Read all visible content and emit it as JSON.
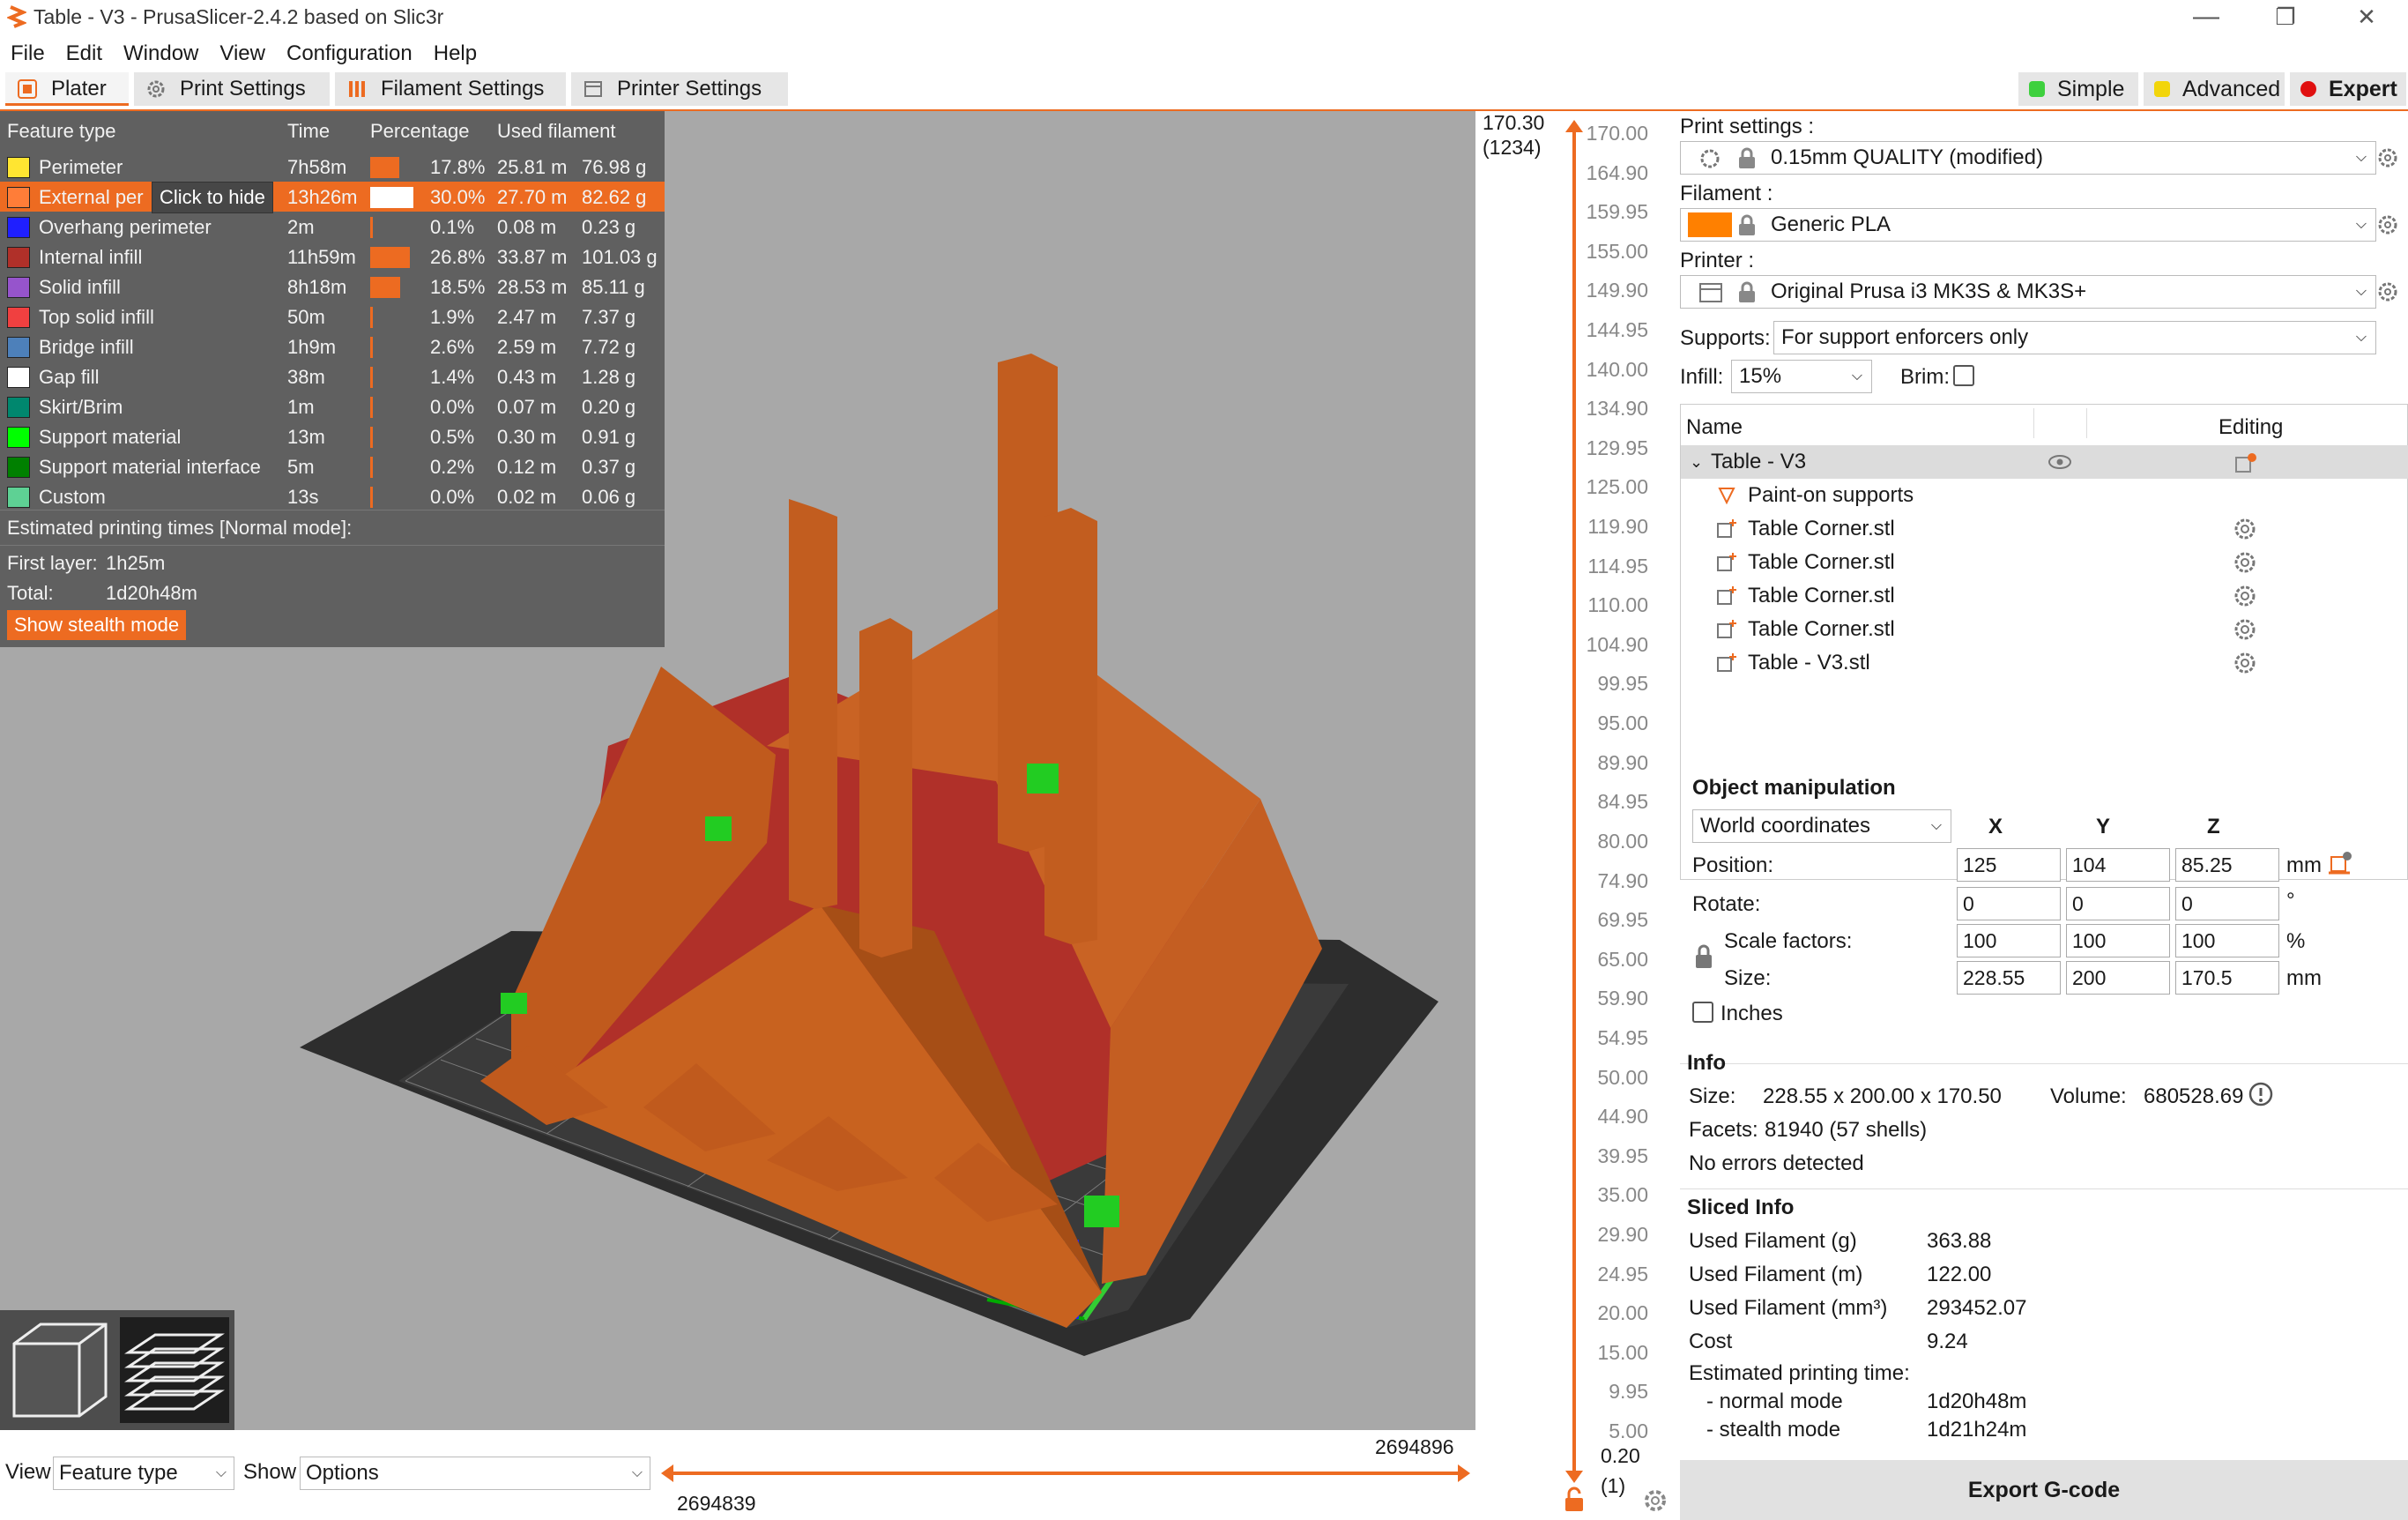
{
  "window": {
    "title": "Table - V3 - PrusaSlicer-2.4.2 based on Slic3r",
    "minimize": "—",
    "maximize": "❐",
    "close": "✕"
  },
  "menu": [
    "File",
    "Edit",
    "Window",
    "View",
    "Configuration",
    "Help"
  ],
  "tabs": [
    {
      "label": "Plater",
      "icon": "plater-icon",
      "color": "#ed6b21"
    },
    {
      "label": "Print Settings",
      "icon": "gear-icon",
      "color": "#777777"
    },
    {
      "label": "Filament Settings",
      "icon": "filament-icon",
      "color": "#ed6b21"
    },
    {
      "label": "Printer Settings",
      "icon": "printer-icon",
      "color": "#777777"
    }
  ],
  "modes": [
    {
      "label": "Simple",
      "color": "#3ed03e"
    },
    {
      "label": "Advanced",
      "color": "#f2d50a"
    },
    {
      "label": "Expert",
      "color": "#e01010"
    }
  ],
  "legend": {
    "headers": {
      "feature": "Feature type",
      "time": "Time",
      "percentage": "Percentage",
      "used": "Used filament"
    },
    "rows": [
      {
        "name": "Perimeter",
        "color": "#ffe531",
        "time": "7h58m",
        "pct": 17.8,
        "pct_text": "17.8%",
        "m": "25.81 m",
        "g": "76.98 g"
      },
      {
        "name": "External per",
        "color": "#ff7d38",
        "time": "13h26m",
        "pct": 30.0,
        "pct_text": "30.0%",
        "m": "27.70 m",
        "g": "82.62 g",
        "highlight": true
      },
      {
        "name": "Overhang perimeter",
        "color": "#1f1fff",
        "time": "2m",
        "pct": 0.1,
        "pct_text": "0.1%",
        "m": "0.08 m",
        "g": "0.23 g"
      },
      {
        "name": "Internal infill",
        "color": "#b03029",
        "time": "11h59m",
        "pct": 26.8,
        "pct_text": "26.8%",
        "m": "33.87 m",
        "g": "101.03 g"
      },
      {
        "name": "Solid infill",
        "color": "#9654cc",
        "time": "8h18m",
        "pct": 18.5,
        "pct_text": "18.5%",
        "m": "28.53 m",
        "g": "85.11 g"
      },
      {
        "name": "Top solid infill",
        "color": "#f04040",
        "time": "50m",
        "pct": 1.9,
        "pct_text": "1.9%",
        "m": "2.47 m",
        "g": "7.37 g"
      },
      {
        "name": "Bridge infill",
        "color": "#4d80ba",
        "time": "1h9m",
        "pct": 2.6,
        "pct_text": "2.6%",
        "m": "2.59 m",
        "g": "7.72 g"
      },
      {
        "name": "Gap fill",
        "color": "#ffffff",
        "time": "38m",
        "pct": 1.4,
        "pct_text": "1.4%",
        "m": "0.43 m",
        "g": "1.28 g"
      },
      {
        "name": "Skirt/Brim",
        "color": "#00876e",
        "time": "1m",
        "pct": 0.0,
        "pct_text": "0.0%",
        "m": "0.07 m",
        "g": "0.20 g"
      },
      {
        "name": "Support material",
        "color": "#00ff00",
        "time": "13m",
        "pct": 0.5,
        "pct_text": "0.5%",
        "m": "0.30 m",
        "g": "0.91 g"
      },
      {
        "name": "Support material interface",
        "color": "#008000",
        "time": "5m",
        "pct": 0.2,
        "pct_text": "0.2%",
        "m": "0.12 m",
        "g": "0.37 g"
      },
      {
        "name": "Custom",
        "color": "#5ed194",
        "time": "13s",
        "pct": 0.0,
        "pct_text": "0.0%",
        "m": "0.02 m",
        "g": "0.06 g"
      }
    ],
    "tooltip": "Click to hide",
    "estimated_title": "Estimated printing times [Normal mode]:",
    "first_layer_label": "First layer:",
    "first_layer_value": "1h25m",
    "total_label": "Total:",
    "total_value": "1d20h48m",
    "stealth_button": "Show stealth mode"
  },
  "vertical_slider": {
    "top_value": "170.30",
    "top_layer": "(1234)",
    "bottom_value": "0.20",
    "bottom_layer": "(1)",
    "ticks": [
      "170.00",
      "164.90",
      "159.95",
      "155.00",
      "149.90",
      "144.95",
      "140.00",
      "134.90",
      "129.95",
      "125.00",
      "119.90",
      "114.95",
      "110.00",
      "104.90",
      "99.95",
      "95.00",
      "89.90",
      "84.95",
      "80.00",
      "74.90",
      "69.95",
      "65.00",
      "59.90",
      "54.95",
      "50.00",
      "44.90",
      "39.95",
      "35.00",
      "29.90",
      "24.95",
      "20.00",
      "15.00",
      "9.95",
      "5.00"
    ]
  },
  "horizontal_slider": {
    "right_value": "2694896",
    "left_value": "2694839"
  },
  "bottom": {
    "view_label": "View",
    "view_value": "Feature type",
    "show_label": "Show",
    "show_value": "Options"
  },
  "sidebar": {
    "print_settings_label": "Print settings :",
    "print_settings_value": "0.15mm QUALITY (modified)",
    "filament_label": "Filament :",
    "filament_value": "Generic PLA",
    "filament_color": "#ff8000",
    "printer_label": "Printer :",
    "printer_value": "Original Prusa i3 MK3S & MK3S+",
    "supports_label": "Supports:",
    "supports_value": "For support enforcers only",
    "infill_label": "Infill:",
    "infill_value": "15%",
    "brim_label": "Brim:",
    "brim_checked": false
  },
  "object_list": {
    "col_name": "Name",
    "col_editing": "Editing",
    "root": "Table - V3",
    "items": [
      {
        "label": "Paint-on supports",
        "icon": "paint-supports-icon"
      },
      {
        "label": "Table Corner.stl",
        "icon": "part-icon"
      },
      {
        "label": "Table Corner.stl",
        "icon": "part-icon"
      },
      {
        "label": "Table Corner.stl",
        "icon": "part-icon"
      },
      {
        "label": "Table Corner.stl",
        "icon": "part-icon"
      },
      {
        "label": "Table - V3.stl",
        "icon": "part-icon"
      }
    ]
  },
  "manipulation": {
    "title": "Object manipulation",
    "coords": "World coordinates",
    "x": "X",
    "y": "Y",
    "z": "Z",
    "position_label": "Position:",
    "position": [
      "125",
      "104",
      "85.25"
    ],
    "position_unit": "mm",
    "rotate_label": "Rotate:",
    "rotate": [
      "0",
      "0",
      "0"
    ],
    "rotate_unit": "°",
    "scale_label": "Scale factors:",
    "scale": [
      "100",
      "100",
      "100"
    ],
    "scale_unit": "%",
    "size_label": "Size:",
    "size": [
      "228.55",
      "200",
      "170.5"
    ],
    "size_unit": "mm",
    "inches_label": "Inches"
  },
  "info": {
    "title": "Info",
    "size_label": "Size:",
    "size_value": "228.55 x 200.00 x 170.50",
    "volume_label": "Volume:",
    "volume_value": "680528.69",
    "facets_label": "Facets:",
    "facets_value": "81940 (57 shells)",
    "errors": "No errors detected"
  },
  "sliced_info": {
    "title": "Sliced Info",
    "rows": [
      {
        "label": "Used Filament (g)",
        "value": "363.88"
      },
      {
        "label": "Used Filament (m)",
        "value": "122.00"
      },
      {
        "label": "Used Filament (mm³)",
        "value": "293452.07"
      },
      {
        "label": "Cost",
        "value": "9.24"
      }
    ],
    "est_label": "Estimated printing time:",
    "normal_label": "- normal mode",
    "normal_value": "1d20h48m",
    "stealth_label": "- stealth mode",
    "stealth_value": "1d21h24m"
  },
  "export_button": "Export G-code"
}
